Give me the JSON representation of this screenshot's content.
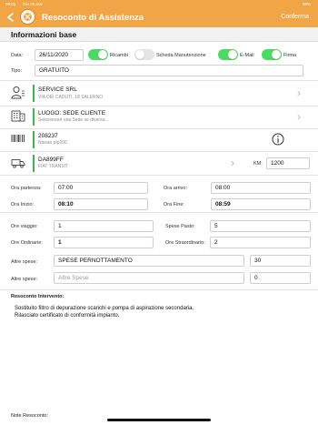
{
  "status_bar": {
    "time": "09:01",
    "date": "Gio 26 nov",
    "battery": "88%"
  },
  "header": {
    "title": "Resoconto di Assistenza",
    "confirm_label": "Conferma"
  },
  "section": {
    "title": "Informazioni base"
  },
  "form": {
    "data_label": "Data:",
    "data_value": "26/11/2020",
    "tipo_label": "Tipo:",
    "tipo_value": "GRATUITO",
    "toggles": [
      {
        "label": "Ricambi",
        "on": true
      },
      {
        "label": "Scheda Manutenzione",
        "on": false
      },
      {
        "label": "E-Mail",
        "on": true
      },
      {
        "label": "Firma",
        "on": true
      }
    ]
  },
  "rows": {
    "customer": {
      "title": "SERVICE SRL",
      "subtitle": "VIA DEI CADUTI, 18 SALERNO"
    },
    "location": {
      "title": "LUOGO: SEDE CLIENTE",
      "subtitle": "Selezionare una Sede se diversa..."
    },
    "product": {
      "title": "208237",
      "subtitle": "Nissan plp200"
    },
    "vehicle": {
      "title": "DA899FF",
      "subtitle": "FIAT TRANSIT",
      "km_label": "KM:",
      "km_value": "1200"
    }
  },
  "times": {
    "partenza_label": "Ora partenza:",
    "partenza_value": "07:00",
    "arrivo_label": "Ora arrivo:",
    "arrivo_value": "08:00",
    "inizio_label": "Ora Inizio:",
    "inizio_value": "08:10",
    "fine_label": "Ora Fine:",
    "fine_value": "08:59"
  },
  "counts": {
    "viaggio_label": "Ore viaggio:",
    "viaggio_value": "1",
    "pasto_label": "Spese Pasto:",
    "pasto_value": "5",
    "ordinarie_label": "Ore Ordinarie:",
    "ordinarie_value": "1",
    "straordinario_label": "Ore Straordinario:",
    "straordinario_value": "2"
  },
  "expenses": [
    {
      "label": "Altre spese:",
      "description": "SPESE PERNOTTAMENTO",
      "placeholder": "",
      "amount": "30"
    },
    {
      "label": "Altre spese:",
      "description": "",
      "placeholder": "Altre Spese",
      "amount": "0"
    }
  ],
  "report": {
    "title": "Resoconto Intervento:",
    "line1": "Sostituito filtro di depurazione scarichi e pompa di aspirazione secondaria.",
    "line2": "Rilasciato certificato di conformità impianto."
  },
  "notes": {
    "title": "Note Resoconto:"
  },
  "colors": {
    "header": "#f0a647",
    "toggle_on": "#4cd964",
    "accent_bar": "#3fb34f"
  },
  "icons": [
    "back-arrow-icon",
    "app-logo-icon",
    "person-icon",
    "building-icon",
    "barcode-icon",
    "info-icon",
    "truck-icon",
    "chevron-right-icon"
  ]
}
